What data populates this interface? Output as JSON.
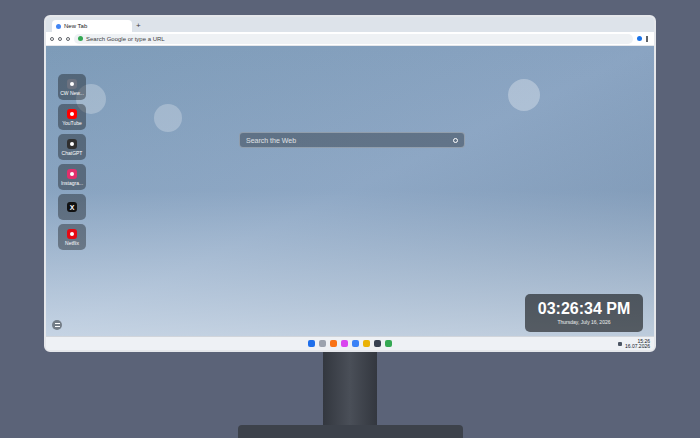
{
  "browser": {
    "tabs": [
      {
        "label": "New Tab",
        "selected": true
      }
    ],
    "new_tab_button": "+",
    "address": {
      "placeholder": "Search Google or type a URL"
    }
  },
  "search": {
    "placeholder": "Search the Web"
  },
  "sidebar": {
    "items": [
      {
        "label": "CW New...",
        "color": "#6b7280"
      },
      {
        "label": "YouTube",
        "color": "#ff0000"
      },
      {
        "label": "ChatGPT",
        "color": "#2f2f2f"
      },
      {
        "label": "Instagra...",
        "color": "#e1306c"
      },
      {
        "glyph": "X",
        "color": "#111111"
      },
      {
        "label": "Netflix",
        "color": "#e50914"
      }
    ]
  },
  "clock": {
    "time": "03:26:34 PM",
    "date": "Thursday, July 16, 2026"
  },
  "taskbar": {
    "time": "15:26",
    "date": "16.07.2026"
  }
}
